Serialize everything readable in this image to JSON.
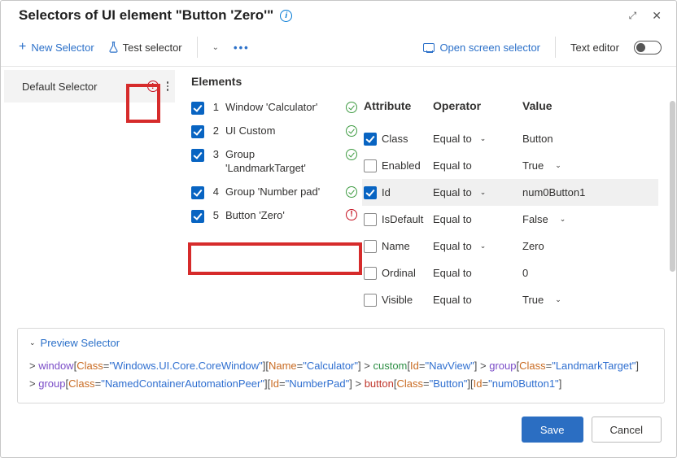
{
  "title": "Selectors of UI element \"Button 'Zero'\"",
  "toolbar": {
    "newSelector": "New Selector",
    "testSelector": "Test selector",
    "openScreen": "Open screen selector",
    "textEditor": "Text editor"
  },
  "sidebar": {
    "selectorName": "Default Selector"
  },
  "elementsHeader": "Elements",
  "elements": [
    {
      "n": "1",
      "label": "Window 'Calculator'",
      "status": "ok"
    },
    {
      "n": "2",
      "label": "UI Custom",
      "status": "ok"
    },
    {
      "n": "3",
      "label": "Group 'LandmarkTarget'",
      "status": "ok"
    },
    {
      "n": "4",
      "label": "Group 'Number pad'",
      "status": "ok"
    },
    {
      "n": "5",
      "label": "Button 'Zero'",
      "status": "err"
    }
  ],
  "attrHeaders": {
    "attr": "Attribute",
    "op": "Operator",
    "val": "Value"
  },
  "attrs": [
    {
      "on": true,
      "name": "Class",
      "op": "Equal to",
      "opChev": true,
      "value": "Button",
      "valChev": false,
      "sel": false
    },
    {
      "on": false,
      "name": "Enabled",
      "op": "Equal to",
      "opChev": false,
      "value": "True",
      "valChev": true,
      "sel": false
    },
    {
      "on": true,
      "name": "Id",
      "op": "Equal to",
      "opChev": true,
      "value": "num0Button1",
      "valChev": false,
      "sel": true
    },
    {
      "on": false,
      "name": "IsDefault",
      "op": "Equal to",
      "opChev": false,
      "value": "False",
      "valChev": true,
      "sel": false
    },
    {
      "on": false,
      "name": "Name",
      "op": "Equal to",
      "opChev": true,
      "value": "Zero",
      "valChev": false,
      "sel": false
    },
    {
      "on": false,
      "name": "Ordinal",
      "op": "Equal to",
      "opChev": false,
      "value": "0",
      "valChev": false,
      "sel": false
    },
    {
      "on": false,
      "name": "Visible",
      "op": "Equal to",
      "opChev": false,
      "value": "True",
      "valChev": true,
      "sel": false
    }
  ],
  "preview": {
    "label": "Preview Selector",
    "seg": {
      "gt": "> ",
      "window": "window",
      "class": "Class",
      "eq": "=",
      "windowClassVal": "\"Windows.UI.Core.CoreWindow\"",
      "name": "Name",
      "windowNameVal": "\"Calculator\"",
      "custom": "custom",
      "id": "Id",
      "customIdVal": "\"NavView\"",
      "group": "group",
      "groupClassVal": "\"LandmarkTarget\"",
      "groupClassVal2": "\"NamedContainerAutomationPeer\"",
      "groupIdVal": "\"NumberPad\"",
      "button": "button",
      "buttonClassVal": "\"Button\"",
      "buttonIdVal": "\"num0Button1\"",
      "lb": "[",
      "rb": "]"
    }
  },
  "footer": {
    "save": "Save",
    "cancel": "Cancel"
  }
}
